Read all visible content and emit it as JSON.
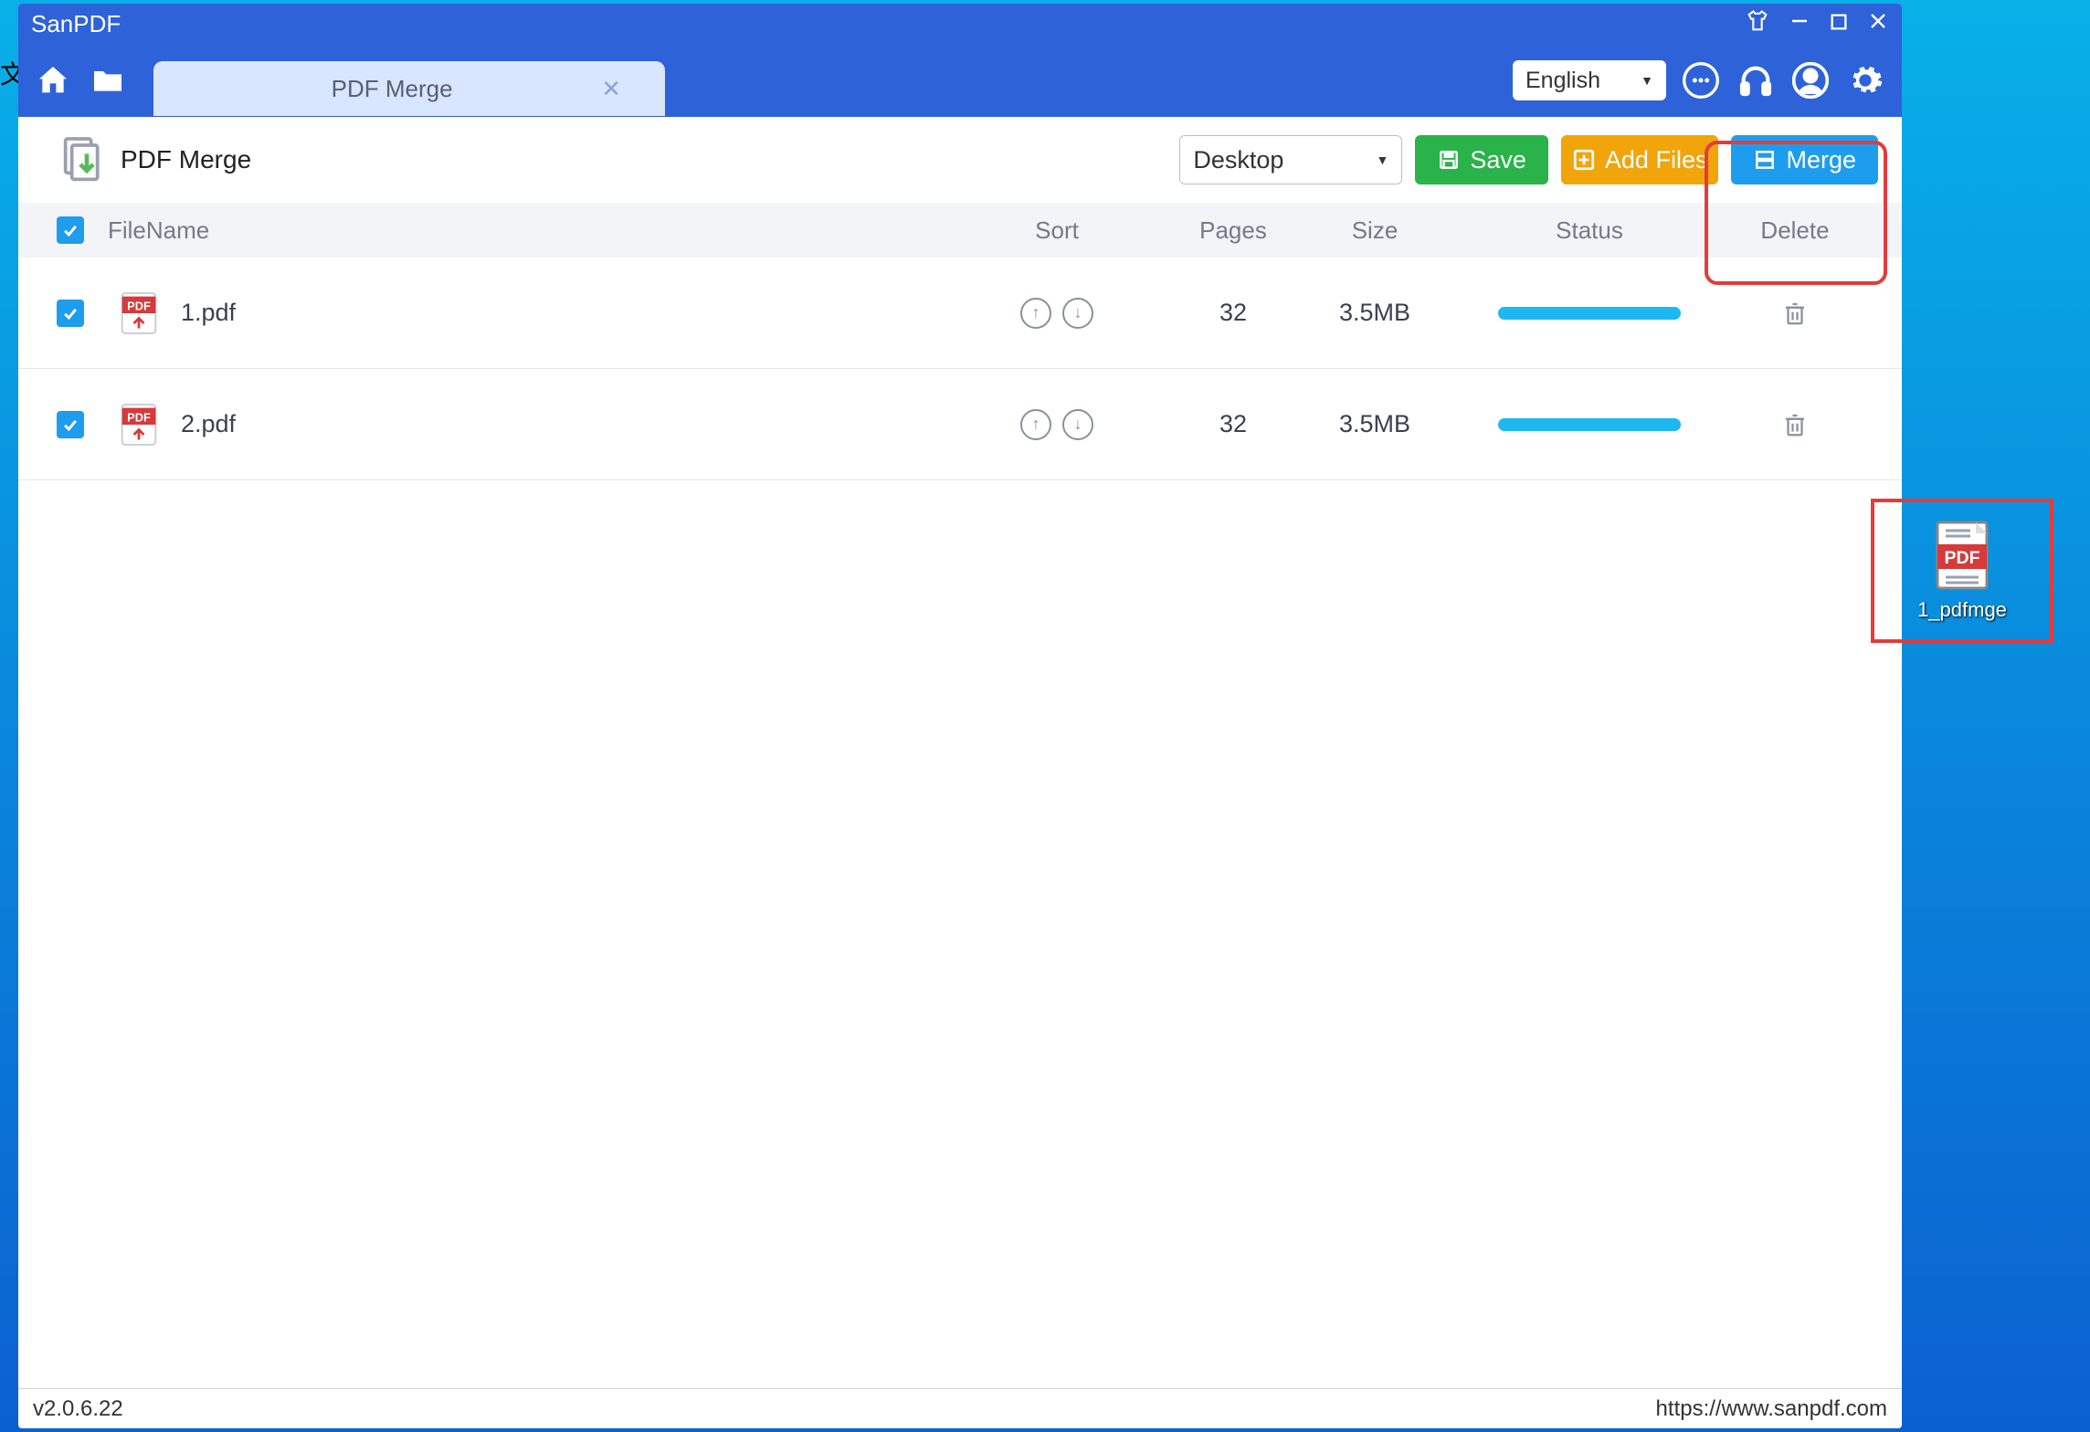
{
  "window": {
    "title": "SanPDF"
  },
  "tab": {
    "label": "PDF Merge"
  },
  "lang": {
    "selected": "English"
  },
  "toolbar": {
    "title": "PDF Merge",
    "destination": "Desktop",
    "save_label": "Save",
    "add_label": "Add Files",
    "merge_label": "Merge"
  },
  "columns": {
    "filename": "FileName",
    "sort": "Sort",
    "pages": "Pages",
    "size": "Size",
    "status": "Status",
    "delete": "Delete"
  },
  "rows": [
    {
      "name": "1.pdf",
      "pages": "32",
      "size": "3.5MB"
    },
    {
      "name": "2.pdf",
      "pages": "32",
      "size": "3.5MB"
    }
  ],
  "statusbar": {
    "version": "v2.0.6.22",
    "url": "https://www.sanpdf.com"
  },
  "desktop_file": {
    "label": "1_pdfmge",
    "badge": "PDF"
  },
  "edge_char": "文"
}
